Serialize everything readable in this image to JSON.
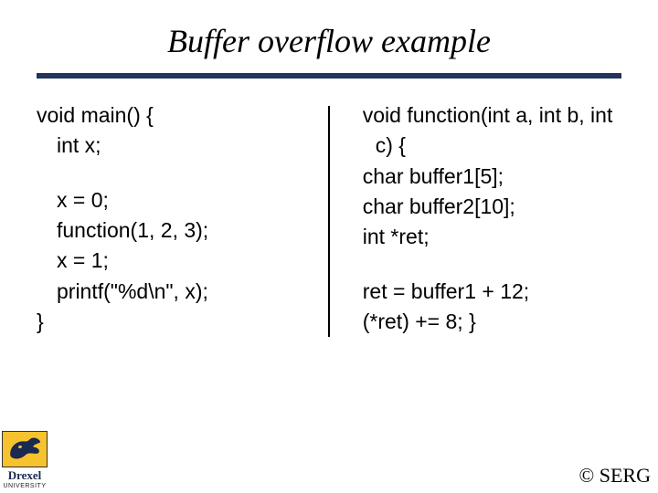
{
  "title": "Buffer overflow example",
  "left": {
    "l1": "void main() {",
    "l2": "int x;",
    "l3": "x = 0;",
    "l4": "function(1, 2, 3);",
    "l5": "x = 1;",
    "l6": "printf(\"%d\\n\", x);",
    "l7": "}"
  },
  "right": {
    "r1": "void function(int a, int b, int c) {",
    "r2": "char buffer1[5];",
    "r3": "char buffer2[10];",
    "r4": "int *ret;",
    "r5": "ret = buffer1 + 12;",
    "r6": "(*ret) += 8; }"
  },
  "logo": {
    "name": "Drexel",
    "sub": "UNIVERSITY"
  },
  "copyright": "© SERG"
}
